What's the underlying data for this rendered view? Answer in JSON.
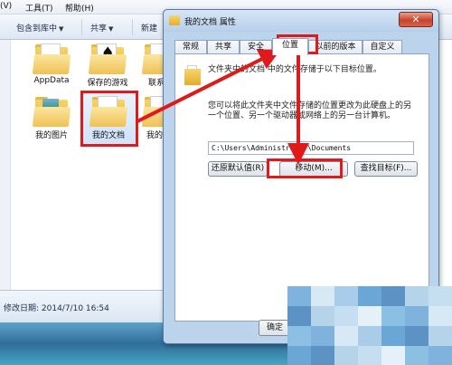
{
  "explorer": {
    "menu": [
      "(V)",
      "工具(T)",
      "帮助(H)"
    ],
    "toolbar": {
      "include_label": "包含到库中",
      "share_label": "共享",
      "new_label": "新建"
    },
    "items": [
      {
        "label": "AppData",
        "icon": "folder-icon"
      },
      {
        "label": "保存的游戏",
        "icon": "saved-games-folder-icon"
      },
      {
        "label": "联系",
        "icon": "contacts-folder-icon"
      },
      {
        "label": "我的图片",
        "icon": "pictures-folder-icon"
      },
      {
        "label": "我的文档",
        "icon": "documents-folder-icon"
      },
      {
        "label": "我的",
        "icon": "folder-icon"
      }
    ],
    "status_text": "修改日期: 2014/7/10 16:54"
  },
  "dialog": {
    "title": "我的文档 属性",
    "close_glyph": "✕",
    "tabs": [
      "常规",
      "共享",
      "安全",
      "位置",
      "以前的版本",
      "自定义"
    ],
    "active_tab": "位置",
    "description1": "文件夹中的文档 中的文件存储于以下目标位置。",
    "description2": "您可以将此文件夹中文件存储的位置更改为此硬盘上的另一个位置、另一个驱动器或网络上的另一台计算机。",
    "path_value": "C:\\Users\\Administrator\\Documents",
    "buttons": {
      "restore": "还原默认值(R)",
      "move": "移动(M)...",
      "find": "查找目标(F)..."
    },
    "ok_label": "确定"
  },
  "colors": {
    "annotation_red": "#e0191a",
    "dialog_bg": "#bcd3ec",
    "close_red": "#c6432a"
  }
}
